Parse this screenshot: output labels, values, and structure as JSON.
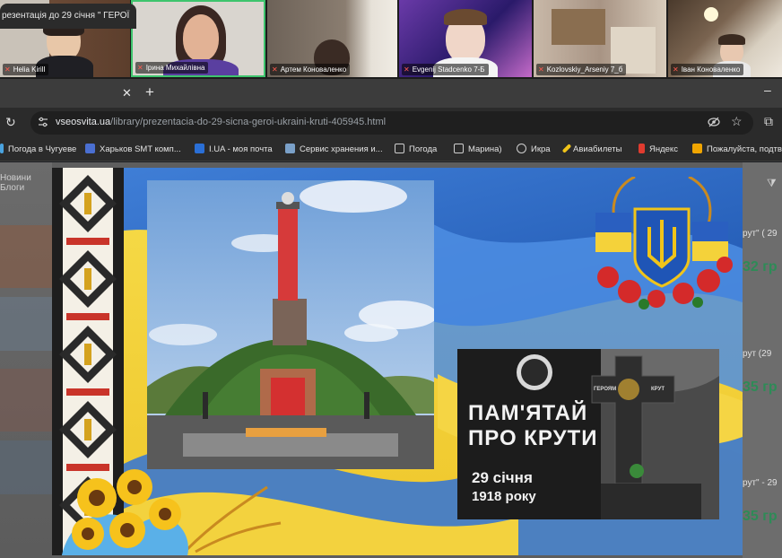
{
  "video_call": {
    "participants": [
      {
        "name": "Helia Kirill"
      },
      {
        "name": "Ірина Михайлівна"
      },
      {
        "name": "Артем Коноваленко"
      },
      {
        "name": "Evgenij Stadcenko 7-Б"
      },
      {
        "name": "Kozlovskiy_Arseniy 7_б"
      },
      {
        "name": "Іван Коноваленко"
      }
    ]
  },
  "browser": {
    "active_tab_title": "резентація до 29 січня \" ГЕРОЇ",
    "url_domain": "vseosvita.ua",
    "url_path": "/library/prezentacia-do-29-sicna-geroi-ukraini-kruti-405945.html",
    "bookmarks": [
      {
        "label": "Погода в Чугуеве",
        "icon": "weather-icon",
        "color": "#4aa3df"
      },
      {
        "label": "Харьков SMT комп...",
        "icon": "smt-icon",
        "color": "#4a6fd1"
      },
      {
        "label": "I.UA - моя почта",
        "icon": "mail-icon",
        "color": "#2a6fd6"
      },
      {
        "label": "Сервис хранения и...",
        "icon": "storage-icon",
        "color": "#7aa0c8"
      },
      {
        "label": "Погода",
        "icon": "folder-icon",
        "color": "#cfcfcf"
      },
      {
        "label": "Марина)",
        "icon": "folder-icon",
        "color": "#cfcfcf"
      },
      {
        "label": "Икра",
        "icon": "globe-icon",
        "color": "#cfcfcf"
      },
      {
        "label": "Авиабилеты",
        "icon": "plane-icon",
        "color": "#f0c419"
      },
      {
        "label": "Яндекс",
        "icon": "yandex-icon",
        "color": "#e03b2f"
      },
      {
        "label": "Пожалуйста, подтв",
        "icon": "bookmark-icon",
        "color": "#f0a500"
      }
    ]
  },
  "page": {
    "left_nav": {
      "line1": "Новини",
      "line2": "Блоги"
    },
    "right_items": [
      {
        "label": "рут\" ( 29",
        "price": "32 гр"
      },
      {
        "label": "рут (29",
        "price": "35 гр"
      },
      {
        "label": "рут\" - 29",
        "price": "35 гр"
      }
    ]
  },
  "slide": {
    "poster_line1": "ПАМ'ЯТАЙ",
    "poster_line2": "ПРО КРУТИ",
    "poster_date": "29 січня",
    "poster_year": "1918 року",
    "cross_left": "ГЕРОЯМ",
    "cross_right": "КРУТ"
  }
}
